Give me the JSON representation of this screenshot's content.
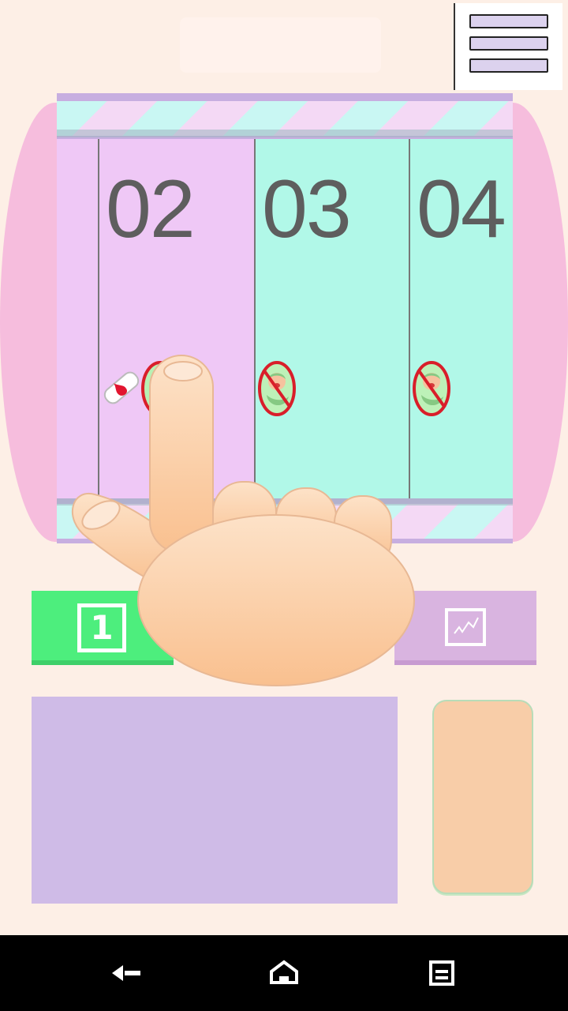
{
  "menu": {
    "icon": "hamburger-menu-icon"
  },
  "reels": [
    {
      "number": "02",
      "color": "#efc8f6",
      "icons": [
        "bandage-icon",
        "no-baby-icon"
      ]
    },
    {
      "number": "03",
      "color": "#b1f8e8",
      "icons": [
        "no-baby-icon"
      ]
    },
    {
      "number": "04",
      "color": "#b1f8e8",
      "icons": [
        "no-baby-icon"
      ]
    }
  ],
  "buttons": {
    "one_label": "1",
    "one_color": "#4dee7d",
    "chart_icon": "chart-icon",
    "chart_color": "#d9b4e0"
  },
  "panels": {
    "info_color": "#cfbbe7",
    "action_color": "#f8cda8"
  },
  "overlay": {
    "icon": "tutorial-hand-icon"
  },
  "nav": {
    "back": "back-icon",
    "home": "home-icon",
    "recents": "recents-icon"
  }
}
